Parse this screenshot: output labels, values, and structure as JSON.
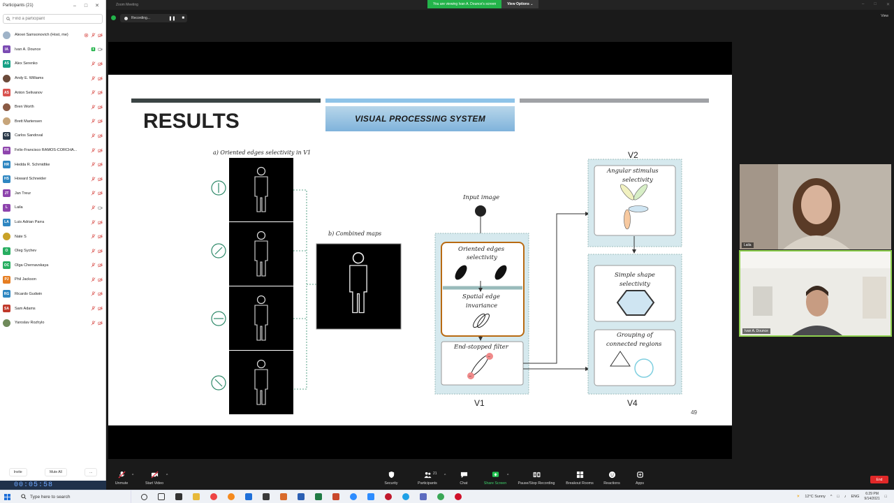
{
  "participants_panel": {
    "title": "Participants (21)",
    "search_placeholder": "Find a participant",
    "participants": [
      {
        "initials": "",
        "name": "Alexei Samsonovich (Host, me)",
        "color": "#9fb3c8",
        "photo": true
      },
      {
        "initials": "IA",
        "name": "Ivan A. Dounce",
        "color": "#7b4bb3"
      },
      {
        "initials": "AS",
        "name": "Alex Serenko",
        "color": "#16a085"
      },
      {
        "initials": "",
        "name": "Andy E. Williams",
        "color": "#6b4a3a",
        "photo": true
      },
      {
        "initials": "AS",
        "name": "Anton Selivanov",
        "color": "#d9534f"
      },
      {
        "initials": "",
        "name": "Bren Worth",
        "color": "#8a5a44",
        "photo": true
      },
      {
        "initials": "",
        "name": "Brett Martensen",
        "color": "#c7a57a",
        "photo": true
      },
      {
        "initials": "CS",
        "name": "Carlos Sandoval",
        "color": "#2b3a4a"
      },
      {
        "initials": "FR",
        "name": "Felix-Francisco RAMOS-CORCHA...",
        "color": "#8e44ad"
      },
      {
        "initials": "HR",
        "name": "Hedda R. Schmidtke",
        "color": "#2e86c1"
      },
      {
        "initials": "HS",
        "name": "Howard Schneider",
        "color": "#2e86c1"
      },
      {
        "initials": "JT",
        "name": "Jan Treur",
        "color": "#8e44ad"
      },
      {
        "initials": "L",
        "name": "Laila",
        "color": "#8e44ad"
      },
      {
        "initials": "LA",
        "name": "Luis Adrian Parra",
        "color": "#2e86c1"
      },
      {
        "initials": "",
        "name": "Nate S",
        "color": "#c9a227",
        "photo": true
      },
      {
        "initials": "O",
        "name": "Oleg Sychev",
        "color": "#27ae60"
      },
      {
        "initials": "OC",
        "name": "Olga Chernavskaya",
        "color": "#27ae60"
      },
      {
        "initials": "PJ",
        "name": "Phil Jackson",
        "color": "#e67e22"
      },
      {
        "initials": "RG",
        "name": "Ricardo Gudwin",
        "color": "#2e86c1"
      },
      {
        "initials": "SA",
        "name": "Sam Adams",
        "color": "#c0392b"
      },
      {
        "initials": "",
        "name": "Yaroslav Rozhylo",
        "color": "#6f8a5a",
        "photo": true
      }
    ],
    "invite_label": "Invite",
    "mute_all_label": "Mute All",
    "more_label": "...",
    "timer": "00:05:58"
  },
  "meeting": {
    "window_title": "Zoom Meeting",
    "viewing_banner": "You are viewing Ivan A. Dounce's screen",
    "view_options": "View Options ⌄",
    "recording_label": "Recording...",
    "view_label": "View"
  },
  "slide": {
    "title": "RESULTS",
    "section": "VISUAL PROCESSING SYSTEM",
    "page_number": "49",
    "bar_colors": [
      "#3b4444",
      "#8ec3e8",
      "#a0a2a6"
    ],
    "diagram": {
      "label_a": "a)  Oriented edges selectivity in V1",
      "label_b": "b)  Combined maps",
      "input_image": "Input image",
      "oriented_edges": [
        "Oriented edges",
        "selectivity"
      ],
      "spatial_invariance": [
        "Spatial edge",
        "invariance"
      ],
      "end_stopped": "End-stopped filter",
      "v1": "V1",
      "v2": "V2",
      "v4": "V4",
      "angular": [
        "Angular stimulus",
        "selectivity"
      ],
      "simple_shape": [
        "Simple shape",
        "selectivity"
      ],
      "grouping": [
        "Grouping of",
        "connected regions"
      ]
    }
  },
  "videos": {
    "laila_name": "Laila",
    "ivan_name": "Ivan A. Dounce"
  },
  "toolbar": {
    "unmute": "Unmute",
    "start_video": "Start Video",
    "security": "Security",
    "participants": "Participants",
    "participants_count": "21",
    "chat": "Chat",
    "share_screen": "Share Screen",
    "pause_stop_recording": "Pause/Stop Recording",
    "breakout_rooms": "Breakout Rooms",
    "reactions": "Reactions",
    "apps": "Apps",
    "end": "End"
  },
  "taskbar": {
    "search_placeholder": "Type here to search",
    "weather": "12°C  Sunny",
    "language": "ENG",
    "time": "6:29 PM",
    "date": "9/14/2021"
  }
}
